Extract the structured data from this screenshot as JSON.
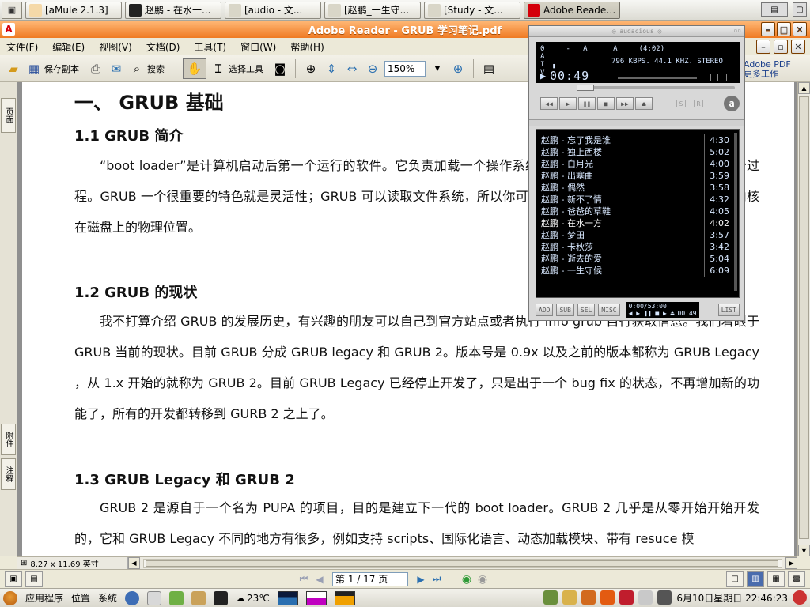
{
  "top_taskbar": {
    "tasks": [
      {
        "label": "[aMule 2.1.3]",
        "color": "#f5d9a8"
      },
      {
        "label": "赵鹏 - 在水一...",
        "color": "#222222"
      },
      {
        "label": "[audio - 文...",
        "color": "#d9d6c8"
      },
      {
        "label": "[赵鹏_一生守...",
        "color": "#d9d6c8"
      },
      {
        "label": "[Study - 文...",
        "color": "#d9d6c8"
      },
      {
        "label": "Adobe Reader...",
        "color": "#d4000a"
      }
    ]
  },
  "window": {
    "title": "Adobe Reader - GRUB 学习笔记.pdf",
    "app_icon": "acrobat-icon"
  },
  "menu": {
    "items": [
      "文件(F)",
      "编辑(E)",
      "视图(V)",
      "文档(D)",
      "工具(T)",
      "窗口(W)",
      "帮助(H)"
    ]
  },
  "toolbar": {
    "save_copy": "保存副本",
    "search": "搜索",
    "select_tool": "选择工具",
    "zoom_value": "150%"
  },
  "adobe_teaser": {
    "line1": "Adobe PDF",
    "line2": "更多工作"
  },
  "nav_tabs": {
    "pages": "页面",
    "attachments": "附件",
    "comments": "注释"
  },
  "document": {
    "h1": "一、 GRUB  基础",
    "s1_title": "1.1     GRUB  简介",
    "p1": "“boot loader”是计算机启动后第一个运行的软件。它负责加载一个操作系统的内核，然后内核则负责剩下的初始过程。GRUB  一个很重要的特色就是灵活性；GRUB  可以读取文件系统，所以你可以加载任何操作系统，而不需要记录内核在磁盘上的物理位置。",
    "s2_title": "1.2     GRUB  的现状",
    "p2": "我不打算介绍  GRUB  的发展历史，有兴趣的朋友可以自己到官方站点或者执行  info grub  自行获取信息。我们着眼于  GRUB  当前的现状。目前  GRUB  分成  GRUB legacy  和  GRUB 2。版本号是  0.9x  以及之前的版本都称为  GRUB Legacy ，从  1.x  开始的就称为  GRUB 2。目前  GRUB Legacy  已经停止开发了，只是出于一个  bug fix  的状态，不再增加新的功能了，所有的开发都转移到  GURB 2  之上了。",
    "s3_title": "1.3     GRUB Legacy  和  GRUB 2",
    "p3": "GRUB 2  是源自于一个名为  PUPA  的项目，目的是建立下一代的  boot loader。GRUB 2  几乎是从零开始开始开发的，它和  GRUB Legacy  不同的地方有很多，例如支持  scripts、国际化语言、动态加载模块、带有  resuce  模"
  },
  "status": {
    "page_size": "8.27 x 11.69 英寸",
    "page_field": "第 1 / 17 页"
  },
  "player": {
    "info_lines": "0     -   A      A     (4:02)\nA                       \nI  ▖               \nV",
    "quality": "796 KBPS. 44.1 KHZ. STEREO",
    "time": "00:49",
    "playlist": [
      {
        "title": "赵鹏 - 忘了我是谁",
        "duration": "4:30"
      },
      {
        "title": "赵鹏 - 独上西楼",
        "duration": "5:02"
      },
      {
        "title": "赵鹏 - 白月光",
        "duration": "4:00"
      },
      {
        "title": "赵鹏 - 出塞曲",
        "duration": "3:59"
      },
      {
        "title": "赵鹏 - 偶然",
        "duration": "3:58"
      },
      {
        "title": "赵鹏 - 新不了情",
        "duration": "4:32"
      },
      {
        "title": "赵鹏 - 爸爸的草鞋",
        "duration": "4:05"
      },
      {
        "title": "赵鹏 - 在水一方",
        "duration": "4:02"
      },
      {
        "title": "赵鹏 - 梦田",
        "duration": "3:57"
      },
      {
        "title": "赵鹏 - 卡秋莎",
        "duration": "3:42"
      },
      {
        "title": "赵鹏 - 逝去的爱",
        "duration": "5:04"
      },
      {
        "title": "赵鹏 - 一生守候",
        "duration": "6:09"
      }
    ],
    "buttons": {
      "add": "ADD",
      "sub": "SUB",
      "sel": "SEL",
      "misc": "MISC",
      "list": "LIST"
    },
    "pl_time": "0:00/53:00",
    "pl_time2": "00:49"
  },
  "bottom_panel": {
    "apps": "应用程序",
    "places": "位置",
    "system": "系统",
    "weather": "23℃",
    "clock": "6月10日星期日 22:46:23"
  }
}
